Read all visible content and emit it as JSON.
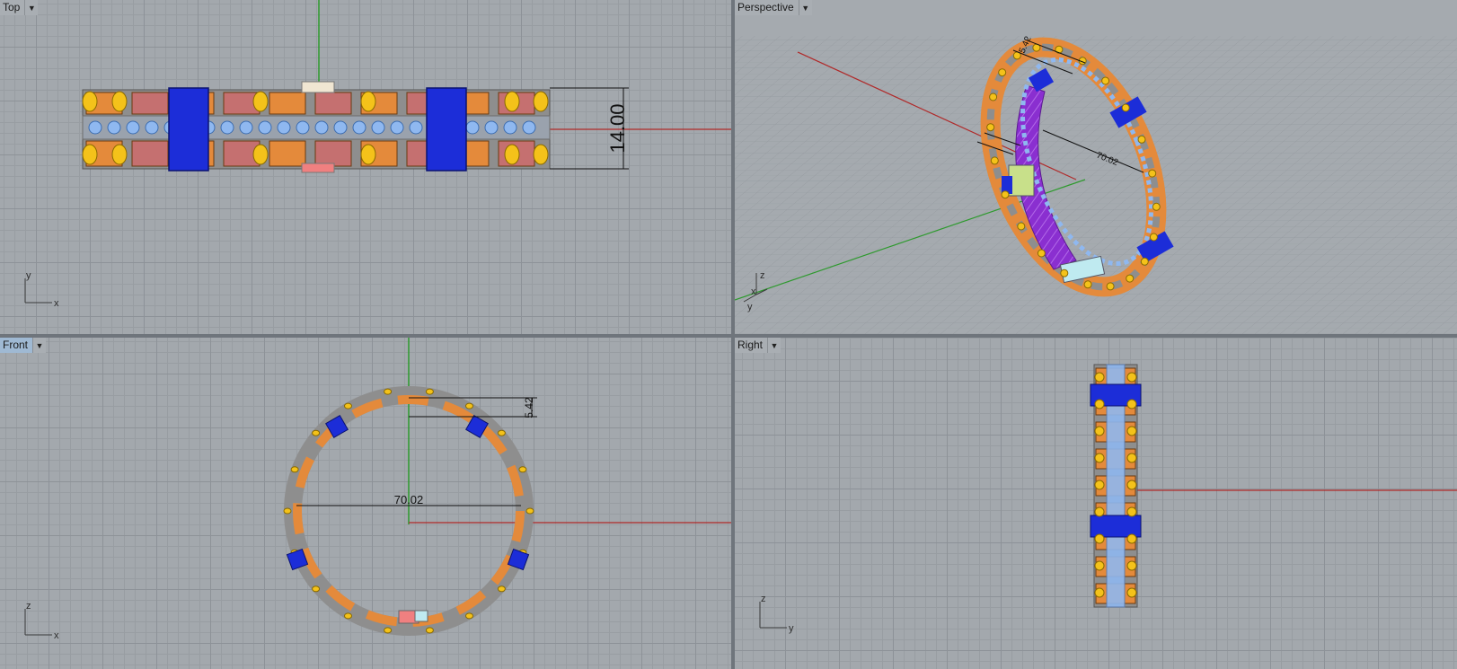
{
  "viewports": {
    "top": {
      "label": "Top",
      "axis_v": "y",
      "axis_h": "x",
      "dimension": "14.00"
    },
    "perspective": {
      "label": "Perspective",
      "axis_z": "z",
      "axis_x": "x",
      "axis_y": "y",
      "dim_a": "5.42",
      "dim_b": "70.02"
    },
    "front": {
      "label": "Front",
      "axis_v": "z",
      "axis_h": "x",
      "dim_height": "5.42",
      "dim_diameter": "70.02"
    },
    "right": {
      "label": "Right",
      "axis_v": "z",
      "axis_h": "y"
    }
  },
  "icons": {
    "viewport_menu": "dropdown-arrow-icon"
  },
  "colors": {
    "grid_background": "#a3a8ad",
    "grid_line": "#8d9298",
    "axis_x": "#b02a2a",
    "axis_y": "#2e9a2e",
    "ring_gray": "#8e8e8e",
    "ring_orange": "#e48a3b",
    "stone_blue": "#8fb8f0",
    "clamp_blue": "#1c2dd8",
    "bolt_yellow": "#f4c21a",
    "inner_purple": "#8a2fd0",
    "active_label": "#9fb9d3"
  }
}
